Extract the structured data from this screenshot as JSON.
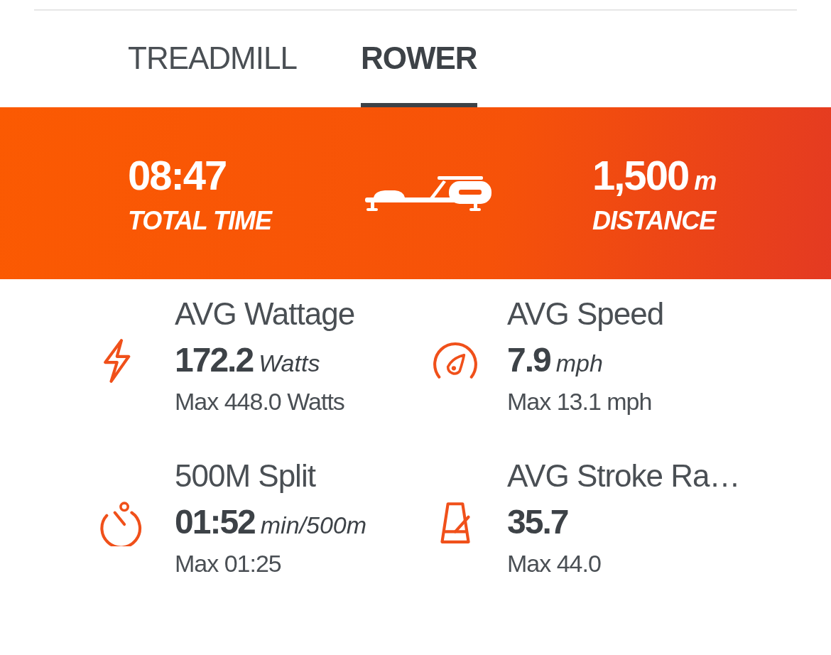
{
  "tabs": [
    {
      "label": "TREADMILL",
      "selected": false
    },
    {
      "label": "ROWER",
      "selected": true
    }
  ],
  "summary": {
    "left": {
      "value": "08:47",
      "label": "TOTAL TIME"
    },
    "right": {
      "value": "1,500",
      "unit": "m",
      "label": "DISTANCE"
    }
  },
  "stats": [
    {
      "kind": "wattage",
      "title": "AVG Wattage",
      "value": "172.2",
      "unit": "Watts",
      "max": "Max 448.0 Watts"
    },
    {
      "kind": "speed",
      "title": "AVG Speed",
      "value": "7.9",
      "unit": "mph",
      "max": "Max 13.1 mph"
    },
    {
      "kind": "split",
      "title": "500M Split",
      "value": "01:52",
      "unit": "min/500m",
      "max": "Max 01:25"
    },
    {
      "kind": "stroke",
      "title": "AVG Stroke Ra…",
      "value": "35.7",
      "max": "Max 44.0"
    }
  ]
}
